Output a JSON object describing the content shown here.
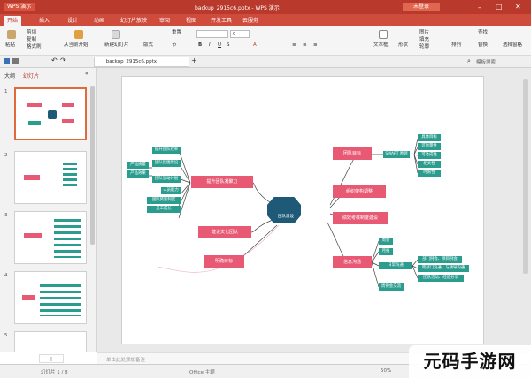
{
  "app": {
    "logo": "WPS 演示",
    "title": "backup_2915c6.pptx - WPS 演示",
    "login_label": "未登录",
    "window_controls": [
      "minimize-icon",
      "maximize-icon",
      "close-icon"
    ]
  },
  "tabs": [
    "开始",
    "插入",
    "设计",
    "动画",
    "幻灯片放映",
    "审阅",
    "视图",
    "开发工具",
    "云服务"
  ],
  "ribbon": {
    "paste": "粘贴",
    "cut": "剪切",
    "copy": "复制",
    "format_painter": "格式刷",
    "from_current": "从当前开始",
    "new_slide": "新建幻灯片",
    "layout": "版式",
    "reset": "重置",
    "section": "节",
    "font_size": "0",
    "text_box": "文本框",
    "shape": "形状",
    "arrange": "排列",
    "picture": "图片",
    "fill": "填充",
    "outline": "轮廓",
    "find": "查找",
    "replace": "替换",
    "select_pane": "选择窗格"
  },
  "qbar": {
    "file_tab": "_backup_2915c6.pptx",
    "search_placeholder": "模板搜索"
  },
  "left_panel": {
    "tab_outline": "大纲",
    "tab_slides": "幻灯片",
    "slide_numbers": [
      "1",
      "2",
      "3",
      "4",
      "5"
    ]
  },
  "mindmap": {
    "center": "团队建设",
    "left_branches": [
      {
        "title": "提升团队凝聚力",
        "children": [
          "提升团队效率",
          "团队氛围建设",
          "团队活动计划",
          "人员能力",
          "团队奖惩制度",
          "员工成长"
        ],
        "outer": [
          "产品质量",
          "产品效果"
        ]
      },
      {
        "title": "建设文化团队",
        "children": []
      },
      {
        "title": "明确目标",
        "children": []
      }
    ],
    "right_branches": [
      {
        "title": "团队目标",
        "mid": "SMART 原则",
        "children": [
          "具体目标",
          "可衡量性",
          "可达成性",
          "相关性",
          "时限性"
        ]
      },
      {
        "title": "组织架构调整",
        "children": []
      },
      {
        "title": "绩效考核制度建设",
        "children": []
      },
      {
        "title": "信息沟通",
        "children": [
          "周会",
          "月报",
          "日常沟通",
          "周例会交流"
        ],
        "sub": [
          "部门例会、项目例会",
          "跨部门沟通、与领导沟通",
          "团队活动、经验分享"
        ]
      }
    ]
  },
  "notes_placeholder": "单击此处添加备注",
  "status": {
    "slide": "幻灯片 1 / 8",
    "theme": "Office 主题",
    "zoom": "50%"
  },
  "watermark": "元码手游网",
  "colors": {
    "title_red": "#b93a2c",
    "tab_red": "#cf4b3c",
    "node_teal": "#2a9d8f",
    "node_pink": "#e85a74",
    "center_navy": "#1e5a78"
  }
}
